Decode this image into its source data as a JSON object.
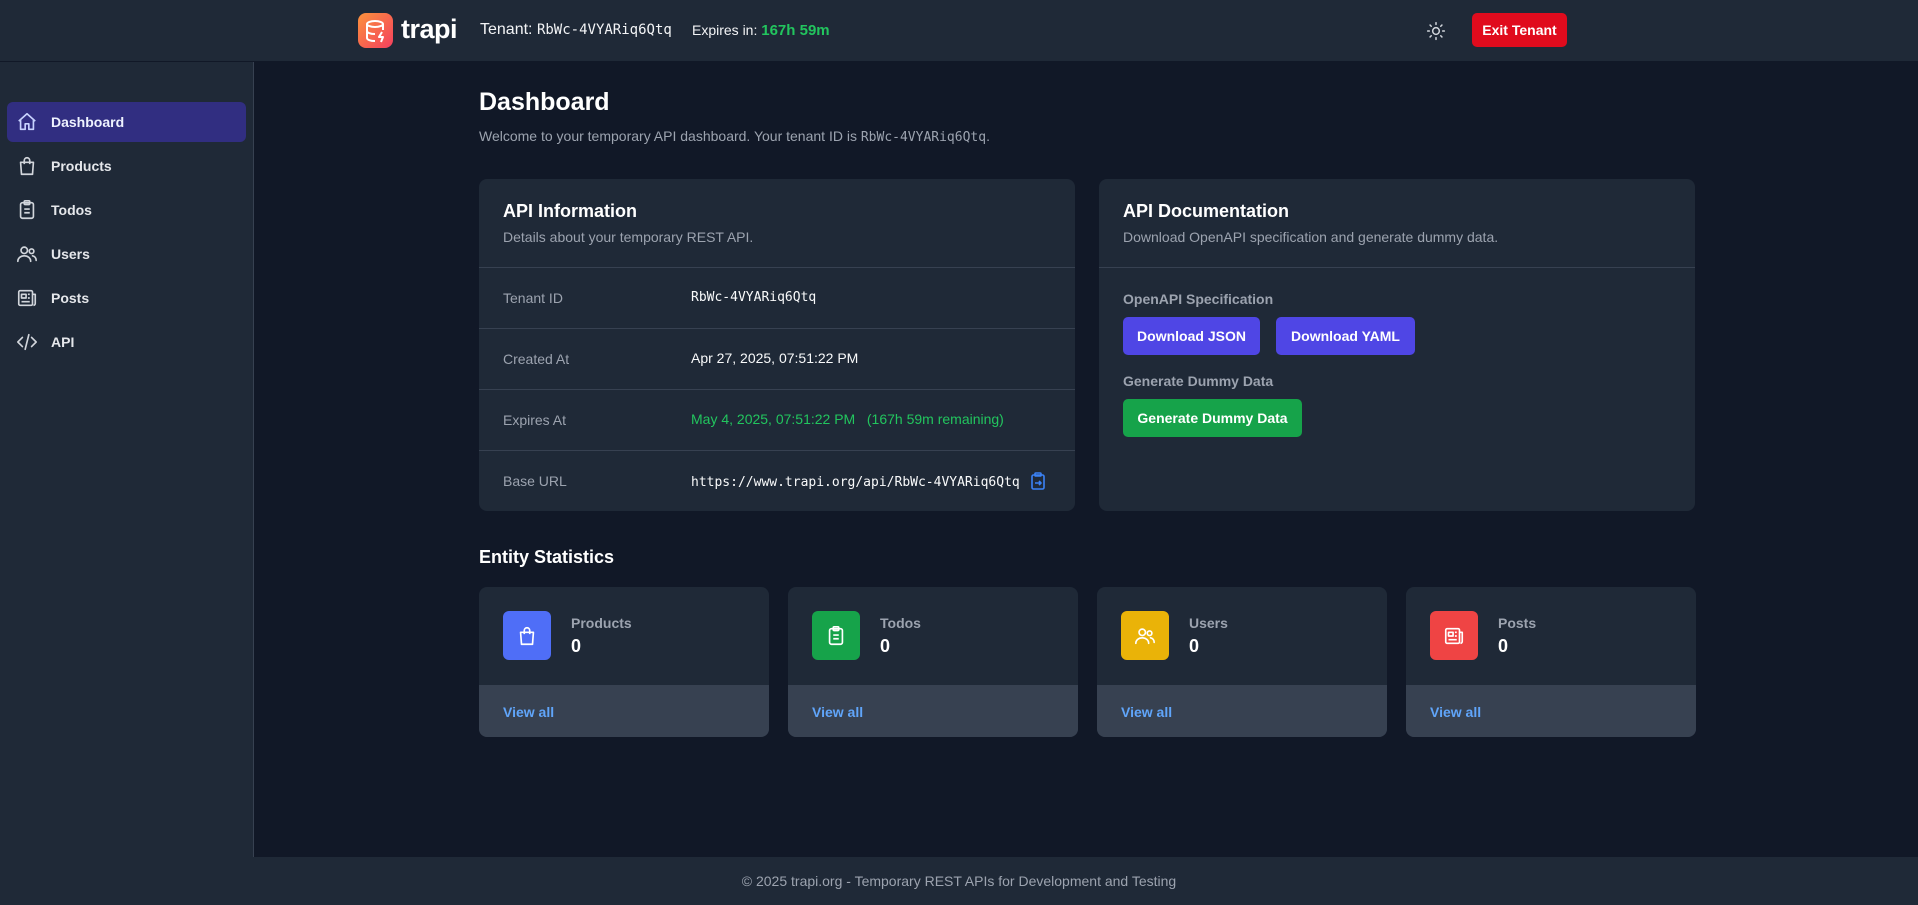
{
  "header": {
    "logo_text": "trapi",
    "tenant_prefix": "Tenant:",
    "tenant_id": "RbWc-4VYARiq6Qtq",
    "expires_prefix": "Expires in:",
    "expires_value": "167h 59m",
    "exit_label": "Exit Tenant"
  },
  "sidebar": {
    "items": [
      {
        "label": "Dashboard",
        "icon": "home-icon",
        "active": true
      },
      {
        "label": "Products",
        "icon": "shopping-bag-icon"
      },
      {
        "label": "Todos",
        "icon": "clipboard-icon"
      },
      {
        "label": "Users",
        "icon": "users-icon"
      },
      {
        "label": "Posts",
        "icon": "newspaper-icon"
      },
      {
        "label": "API",
        "icon": "code-icon"
      }
    ]
  },
  "main": {
    "title": "Dashboard",
    "subtitle_prefix": "Welcome to your temporary API dashboard. Your tenant ID is",
    "subtitle_id": "RbWc-4VYARiq6Qtq",
    "subtitle_suffix": "."
  },
  "api_info": {
    "title": "API Information",
    "description": "Details about your temporary REST API.",
    "rows": [
      {
        "key": "Tenant ID",
        "value": "RbWc-4VYARiq6Qtq"
      },
      {
        "key": "Created At",
        "value": "Apr 27, 2025, 07:51:22 PM"
      },
      {
        "key": "Expires At",
        "value": "May 4, 2025, 07:51:22 PM",
        "extra": "(167h 59m remaining)"
      },
      {
        "key": "Base URL",
        "value": "https://www.trapi.org/api/RbWc-4VYARiq6Qtq"
      }
    ]
  },
  "api_docs": {
    "title": "API Documentation",
    "description": "Download OpenAPI specification and generate dummy data.",
    "openapi_label": "OpenAPI Specification",
    "download_json": "Download JSON",
    "download_yaml": "Download YAML",
    "dummy_label": "Generate Dummy Data",
    "dummy_button": "Generate Dummy Data"
  },
  "stats": {
    "title": "Entity Statistics",
    "view_all": "View all",
    "items": [
      {
        "name": "Products",
        "count": "0",
        "color": "#4f6ef7",
        "icon": "shopping-bag-icon"
      },
      {
        "name": "Todos",
        "count": "0",
        "color": "#16a34a",
        "icon": "clipboard-icon"
      },
      {
        "name": "Users",
        "count": "0",
        "color": "#eab308",
        "icon": "users-icon"
      },
      {
        "name": "Posts",
        "count": "0",
        "color": "#ef4444",
        "icon": "newspaper-icon"
      }
    ]
  },
  "footer": {
    "text": "© 2025 trapi.org - Temporary REST APIs for Development and Testing"
  },
  "colors": {
    "accent": "#4f46e5",
    "danger": "#e00b1d",
    "success": "#22c55e",
    "link": "#60a5fa"
  }
}
